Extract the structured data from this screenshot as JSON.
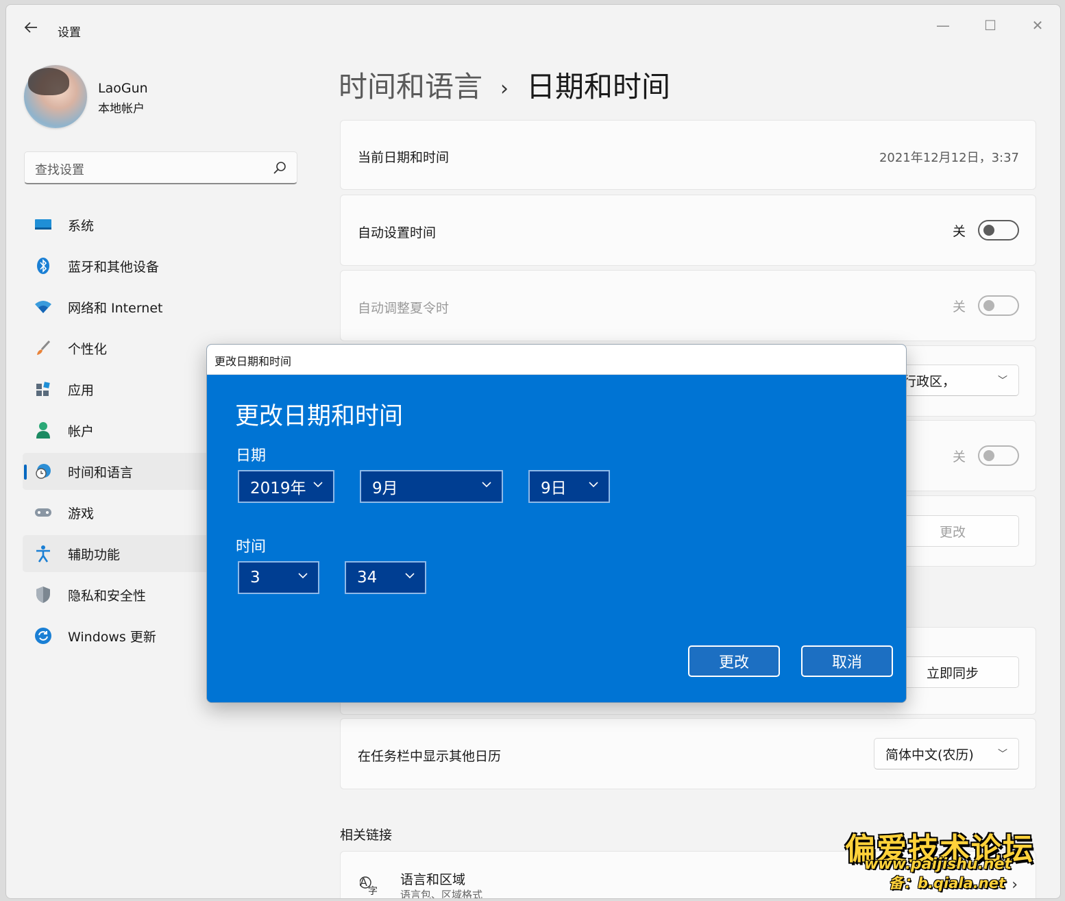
{
  "window": {
    "app_title": "设置",
    "controls": {
      "minimize": "—",
      "maximize": "☐",
      "close": "✕"
    }
  },
  "profile": {
    "name": "LaoGun",
    "account_type": "本地帐户"
  },
  "search": {
    "placeholder": "查找设置"
  },
  "sidebar": {
    "items": [
      {
        "label": "系统",
        "icon": "monitor-icon"
      },
      {
        "label": "蓝牙和其他设备",
        "icon": "bluetooth-icon"
      },
      {
        "label": "网络和 Internet",
        "icon": "wifi-icon"
      },
      {
        "label": "个性化",
        "icon": "brush-icon"
      },
      {
        "label": "应用",
        "icon": "apps-icon"
      },
      {
        "label": "帐户",
        "icon": "person-icon"
      },
      {
        "label": "时间和语言",
        "icon": "clock-globe-icon",
        "selected": true
      },
      {
        "label": "游戏",
        "icon": "gamepad-icon"
      },
      {
        "label": "辅助功能",
        "icon": "accessibility-icon",
        "hovered": true
      },
      {
        "label": "隐私和安全性",
        "icon": "shield-icon"
      },
      {
        "label": "Windows 更新",
        "icon": "update-icon"
      }
    ]
  },
  "breadcrumb": {
    "parent": "时间和语言",
    "separator": "›",
    "current": "日期和时间"
  },
  "cards": {
    "current_datetime": {
      "label": "当前日期和时间",
      "value": "2021年12月12日，3:37"
    },
    "auto_time": {
      "label": "自动设置时间",
      "state": "关"
    },
    "auto_dst": {
      "label": "自动调整夏令时",
      "state": "关"
    },
    "timezone": {
      "value_partial": "特别行政区，"
    },
    "auto_timezone": {
      "state": "关"
    },
    "manual_set": {
      "button": "更改"
    },
    "sync": {
      "button": "立即同步"
    },
    "calendar": {
      "label": "在任务栏中显示其他日历",
      "value": "简体中文(农历)"
    }
  },
  "related": {
    "title": "相关链接",
    "links": [
      {
        "title": "语言和区域",
        "subtitle": "语言包、区域格式",
        "icon": "language-icon"
      }
    ]
  },
  "dialog": {
    "window_title": "更改日期和时间",
    "heading": "更改日期和时间",
    "date_label": "日期",
    "year": "2019年",
    "month": "9月",
    "day": "9日",
    "time_label": "时间",
    "hour": "3",
    "minute": "34",
    "confirm": "更改",
    "cancel": "取消"
  },
  "watermark": {
    "title": "偏爱技术论坛",
    "url": "www.paijishu.net",
    "backup": "备：b.qiala.net"
  },
  "colors": {
    "accent": "#0067c0",
    "dialog_bg": "#0074d4",
    "dialog_select": "#003e92",
    "watermark": "#ffd23a"
  }
}
